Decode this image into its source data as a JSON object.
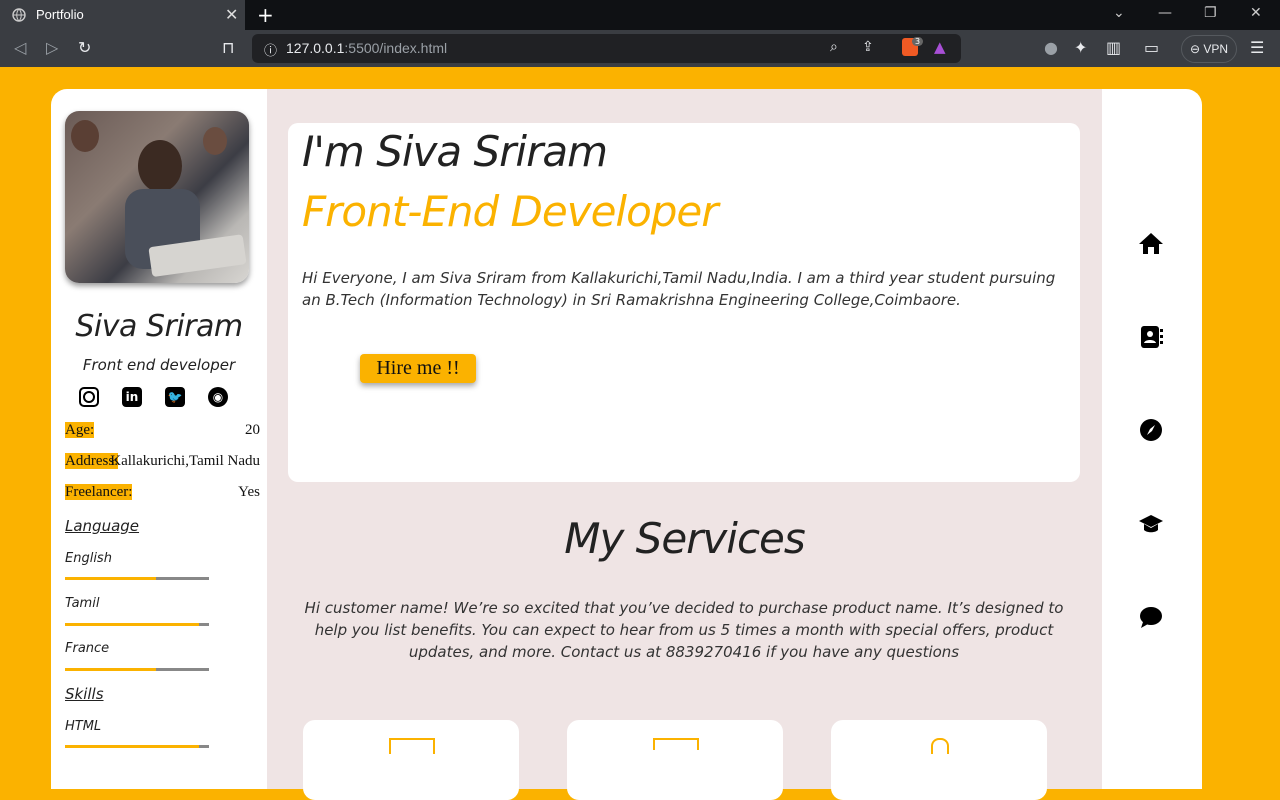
{
  "browser": {
    "tab_title": "Portfolio",
    "url_host": "127.0.0.1",
    "url_rest": ":5500/index.html",
    "vpn_label": "VPN",
    "shield_count": "3"
  },
  "profile": {
    "name": "Siva Sriram",
    "role": "Front end developer",
    "socials": [
      "instagram",
      "linkedin",
      "twitter",
      "github"
    ],
    "info": [
      {
        "key": "Age:",
        "value": "20"
      },
      {
        "key": "Address:",
        "value": "Kallakurichi,Tamil Nadu"
      },
      {
        "key": "Freelancer:",
        "value": "Yes"
      }
    ],
    "language_heading": "Language",
    "languages": [
      {
        "name": "English",
        "level": 0.63
      },
      {
        "name": "Tamil",
        "level": 0.93
      },
      {
        "name": "France",
        "level": 0.63
      }
    ],
    "skills_heading": "Skills",
    "skills": [
      {
        "name": "HTML",
        "level": 0.93
      }
    ]
  },
  "hero": {
    "greeting": "I'm Siva Sriram",
    "title": "Front-End Developer",
    "bio": "Hi Everyone, I am Siva Sriram from Kallakurichi,Tamil Nadu,India. I am a third year student pursuing an B.Tech (Information Technology) in Sri Ramakrishna Engineering College,Coimbaore.",
    "hire_button": "Hire me !!"
  },
  "services": {
    "heading": "My Services",
    "text": "Hi customer name! We’re so excited that you’ve decided to purchase product name. It’s designed to help you list benefits. You can expect to hear from us 5 times a month with special offers, product updates, and more. Contact us at 8839270416 if you have any questions"
  },
  "right_nav": [
    "home-icon",
    "contact-book-icon",
    "compass-icon",
    "graduation-cap-icon",
    "chat-icon"
  ],
  "colors": {
    "accent": "#fbb200",
    "panel": "#efe4e4"
  }
}
